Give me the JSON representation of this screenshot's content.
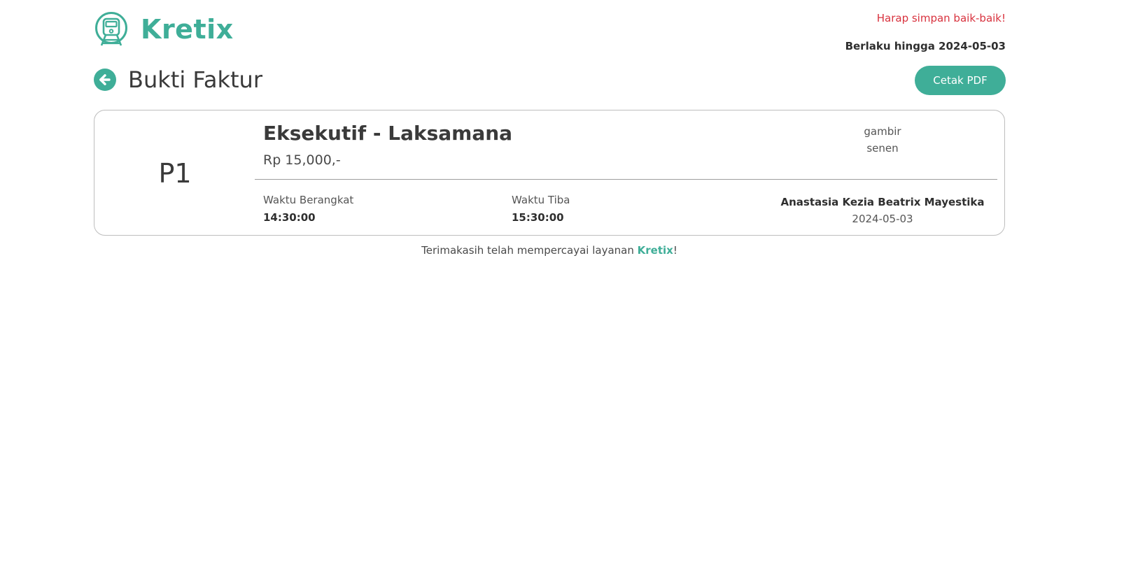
{
  "header": {
    "brand_name": "Kretix",
    "warning": "Harap simpan baik-baik!",
    "valid_until": "Berlaku hingga 2024-05-03",
    "page_title": "Bukti Faktur",
    "print_button": "Cetak PDF"
  },
  "ticket": {
    "seat": "P1",
    "train_name": "Eksekutif - Laksamana",
    "price": "Rp 15,000,-",
    "origin": "gambir",
    "destination": "senen",
    "departure_label": "Waktu Berangkat",
    "departure_time": "14:30:00",
    "arrival_label": "Waktu Tiba",
    "arrival_time": "15:30:00",
    "passenger_name": "Anastasia Kezia Beatrix Mayestika",
    "travel_date": "2024-05-03"
  },
  "footer": {
    "thanks_prefix": "Terimakasih telah mempercayai layanan ",
    "brand": "Kretix",
    "suffix": "!"
  },
  "icons": {
    "logo": "train-icon",
    "back": "arrow-left-circle-icon"
  },
  "colors": {
    "accent": "#3fae98",
    "warning": "#d8323e"
  }
}
